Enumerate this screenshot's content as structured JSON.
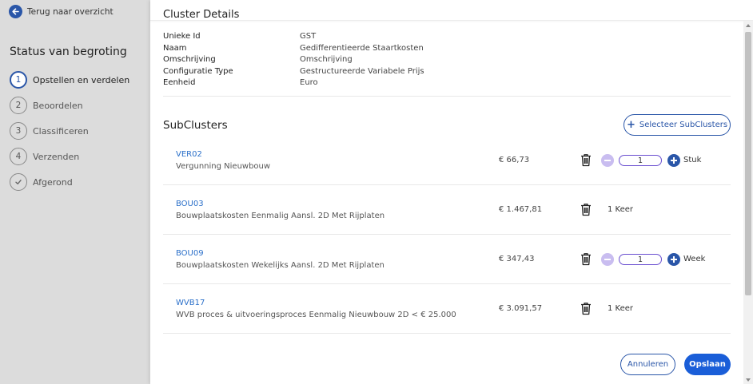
{
  "sidebar": {
    "back_label": "Terug naar overzicht",
    "title": "Status van begroting",
    "steps": [
      {
        "num": "1",
        "label": "Opstellen en verdelen",
        "state": "active"
      },
      {
        "num": "2",
        "label": "Beoordelen",
        "state": "pending"
      },
      {
        "num": "3",
        "label": "Classificeren",
        "state": "pending"
      },
      {
        "num": "4",
        "label": "Verzenden",
        "state": "pending"
      },
      {
        "icon": "check-icon",
        "label": "Afgerond",
        "state": "pending"
      }
    ]
  },
  "panel": {
    "title": "Cluster Details",
    "details": [
      {
        "label": "Unieke Id",
        "value": "GST"
      },
      {
        "label": "Naam",
        "value": "Gedifferentieerde Staartkosten"
      },
      {
        "label": "Omschrijving",
        "value": "Omschrijving"
      },
      {
        "label": "Configuratie Type",
        "value": "Gestructureerde Variabele Prijs"
      },
      {
        "label": "Eenheid",
        "value": "Euro"
      }
    ],
    "subclusters_title": "SubClusters",
    "select_button": "Selecteer SubClusters",
    "subclusters": [
      {
        "code": "VER02",
        "description": "Vergunning Nieuwbouw",
        "price": "€ 66,73",
        "quantity": "1",
        "unit": "Stuk",
        "editable": true
      },
      {
        "code": "BOU03",
        "description": "Bouwplaatskosten Eenmalig Aansl. 2D Met Rijplaten",
        "price": "€ 1.467,81",
        "quantity": "1",
        "unit": "1 Keer",
        "editable": false
      },
      {
        "code": "BOU09",
        "description": "Bouwplaatskosten Wekelijks Aansl. 2D Met Rijplaten",
        "price": "€ 347,43",
        "quantity": "1",
        "unit": "Week",
        "editable": true
      },
      {
        "code": "WVB17",
        "description": "WVB proces & uitvoeringsproces Eenmalig Nieuwbouw 2D < € 25.000",
        "price": "€ 3.091,57",
        "quantity": "1",
        "unit": "1 Keer",
        "editable": false
      }
    ],
    "cancel_button": "Annuleren",
    "save_button": "Opslaan"
  },
  "colors": {
    "accent": "#2a56a8",
    "save": "#1a5ed8",
    "link": "#2a6fc9",
    "qty_border": "#6a4fd0",
    "minus_bg": "#c9bdf0",
    "sidebar_bg": "#dcdcdc"
  }
}
